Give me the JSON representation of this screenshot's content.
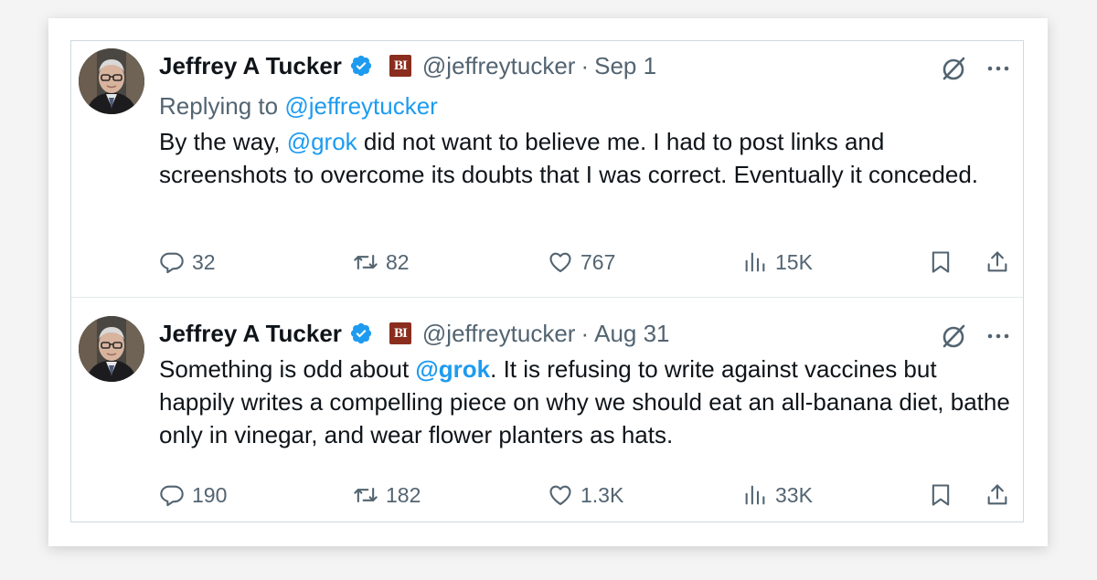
{
  "tweets": [
    {
      "name": "Jeffrey A Tucker",
      "badge": "BI",
      "handle": "@jeffreytucker",
      "separator": "·",
      "date": "Sep 1",
      "replying_prefix": "Replying to ",
      "replying_handle": "@jeffreytucker",
      "text_mention": "@grok",
      "text_before": "By the way, ",
      "text_after": " did not want to believe me. I had to post links and screenshots to overcome its doubts that I was correct. Eventually it conceded.",
      "stats": {
        "replies": "32",
        "reposts": "82",
        "likes": "767",
        "views": "15K"
      }
    },
    {
      "name": "Jeffrey A Tucker",
      "badge": "BI",
      "handle": "@jeffreytucker",
      "separator": "·",
      "date": "Aug 31",
      "text_before": "Something is odd about ",
      "text_mention": "@grok",
      "text_after": ". It is refusing to write against vaccines but happily writes a compelling piece on why we should eat an all-banana diet, bathe only in vinegar, and wear flower planters as hats.",
      "stats": {
        "replies": "190",
        "reposts": "182",
        "likes": "1.3K",
        "views": "33K"
      }
    }
  ],
  "colors": {
    "link": "#1d9bf0",
    "secondary_text": "#536471",
    "verified": "#1d9bf0",
    "badge_bg": "#8a2d1e"
  },
  "icons": [
    "verified-icon",
    "grok-icon",
    "more-icon",
    "reply-icon",
    "repost-icon",
    "like-icon",
    "views-icon",
    "bookmark-icon",
    "share-icon"
  ]
}
